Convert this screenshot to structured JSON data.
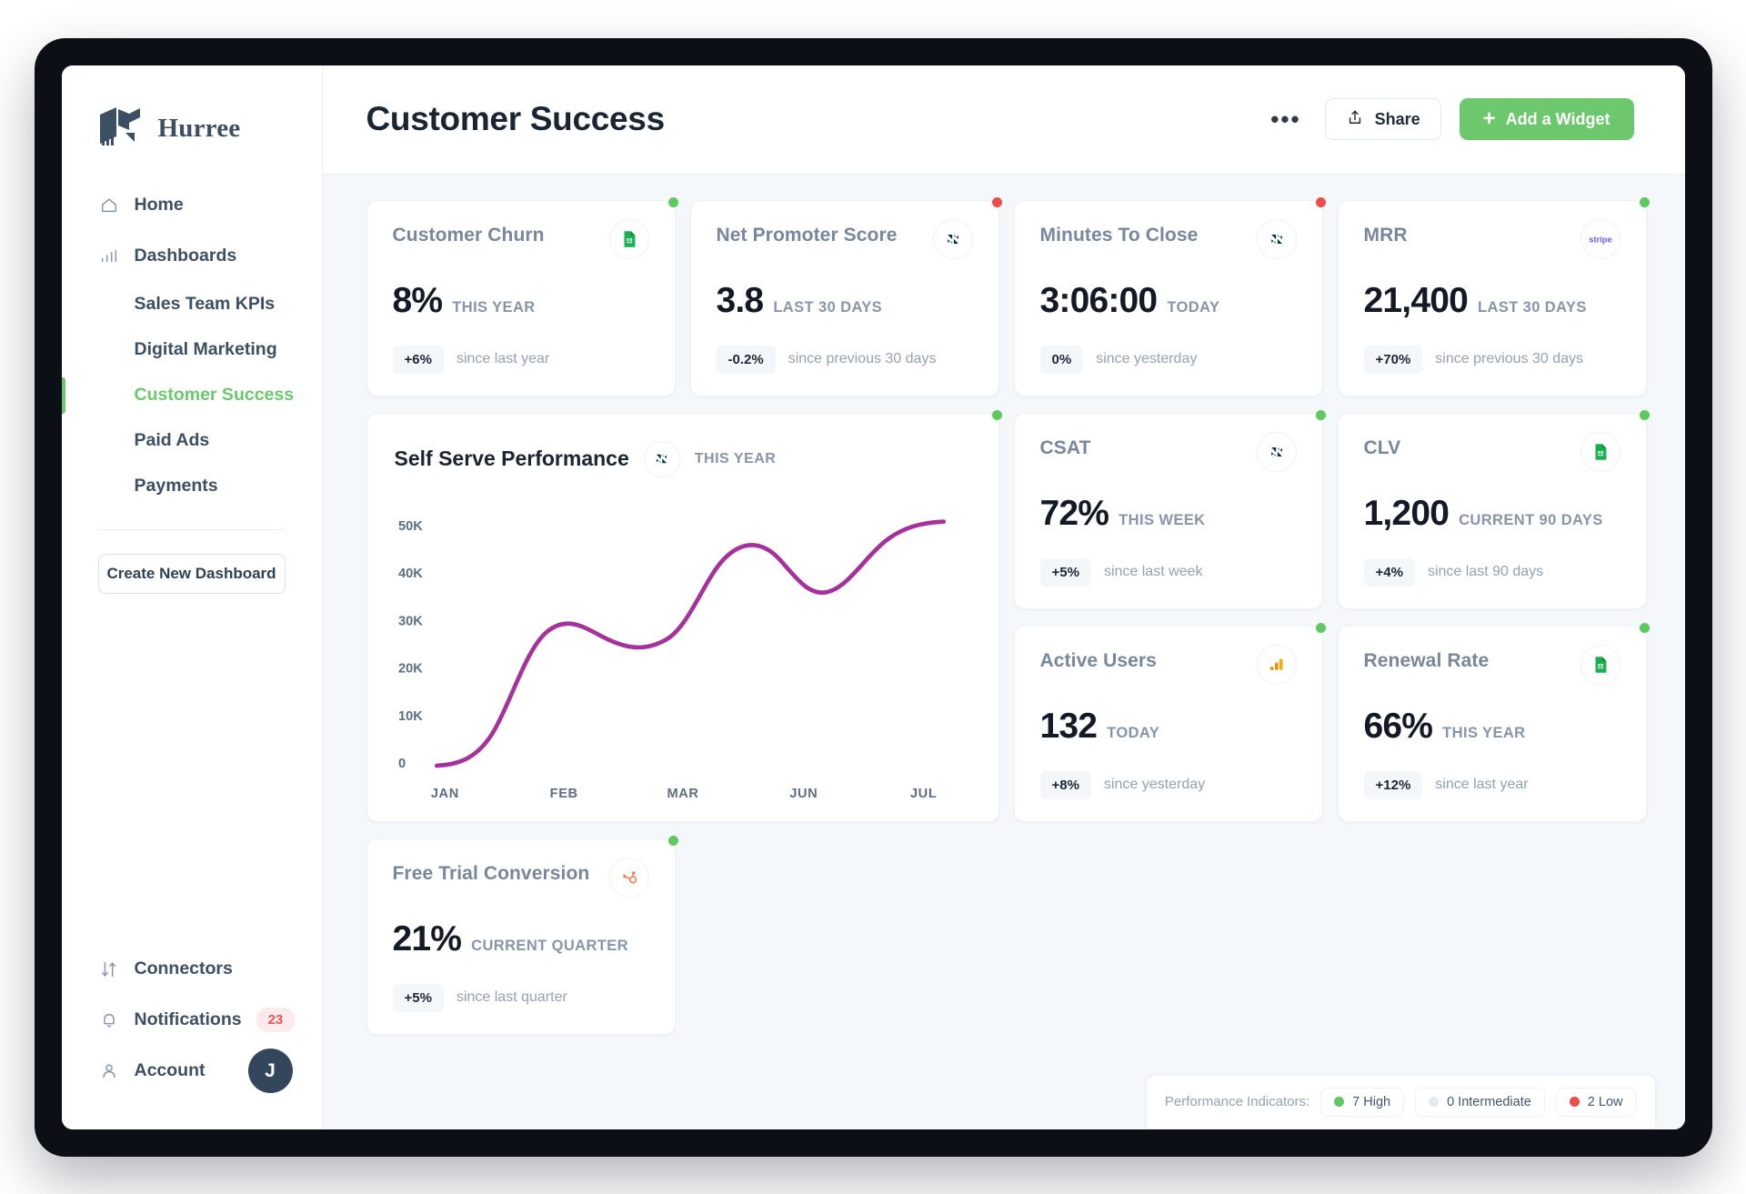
{
  "brand": {
    "name": "Hurree",
    "logo_icon": "hurree-logo-icon"
  },
  "sidebar": {
    "primary": [
      {
        "label": "Home",
        "icon": "home-icon"
      },
      {
        "label": "Dashboards",
        "icon": "bar-chart-icon"
      }
    ],
    "dashboards": [
      {
        "label": "Sales Team KPIs",
        "active": false
      },
      {
        "label": "Digital Marketing",
        "active": false
      },
      {
        "label": "Customer Success",
        "active": true
      },
      {
        "label": "Paid Ads",
        "active": false
      },
      {
        "label": "Payments",
        "active": false
      }
    ],
    "create_button": "Create New Dashboard",
    "bottom": [
      {
        "label": "Connectors",
        "icon": "transfer-icon"
      },
      {
        "label": "Notifications",
        "icon": "bell-icon",
        "badge": "23"
      },
      {
        "label": "Account",
        "icon": "user-icon",
        "avatar": "J"
      }
    ]
  },
  "header": {
    "title": "Customer Success",
    "more_label": "•••",
    "share_label": "Share",
    "add_widget_label": "Add a Widget"
  },
  "cards": [
    {
      "title": "Customer Churn",
      "value": "8%",
      "period": "THIS YEAR",
      "delta": "+6%",
      "delta_label": "since last year",
      "source_icon": "google-sheets-icon",
      "status": "high"
    },
    {
      "title": "Net Promoter Score",
      "value": "3.8",
      "period": "LAST 30 DAYS",
      "delta": "-0.2%",
      "delta_label": "since previous 30 days",
      "source_icon": "zendesk-icon",
      "status": "low"
    },
    {
      "title": "Minutes To Close",
      "value": "3:06:00",
      "period": "TODAY",
      "delta": "0%",
      "delta_label": "since yesterday",
      "source_icon": "zendesk-icon",
      "status": "low"
    },
    {
      "title": "MRR",
      "value": "21,400",
      "period": "LAST 30 DAYS",
      "delta": "+70%",
      "delta_label": "since previous 30 days",
      "source_icon": "stripe-icon",
      "status": "high"
    },
    {
      "title": "CSAT",
      "value": "72%",
      "period": "THIS WEEK",
      "delta": "+5%",
      "delta_label": "since last week",
      "source_icon": "zendesk-icon",
      "status": "high"
    },
    {
      "title": "CLV",
      "value": "1,200",
      "period": "CURRENT 90 DAYS",
      "delta": "+4%",
      "delta_label": "since last 90 days",
      "source_icon": "google-sheets-icon",
      "status": "high"
    },
    {
      "title": "Active Users",
      "value": "132",
      "period": "TODAY",
      "delta": "+8%",
      "delta_label": "since yesterday",
      "source_icon": "google-analytics-icon",
      "status": "high"
    },
    {
      "title": "Renewal Rate",
      "value": "66%",
      "period": "THIS YEAR",
      "delta": "+12%",
      "delta_label": "since last year",
      "source_icon": "google-sheets-icon",
      "status": "high"
    },
    {
      "title": "Free Trial Conversion",
      "value": "21%",
      "period": "CURRENT QUARTER",
      "delta": "+5%",
      "delta_label": "since last quarter",
      "source_icon": "hubspot-icon",
      "status": "high"
    }
  ],
  "chart_card": {
    "title": "Self Serve Performance",
    "period": "THIS YEAR",
    "source_icon": "zendesk-icon",
    "status": "high"
  },
  "chart_data": {
    "type": "line",
    "title": "Self Serve Performance",
    "subtitle": "THIS YEAR",
    "xlabel": "",
    "ylabel": "",
    "categories": [
      "JAN",
      "FEB",
      "MAR",
      "JUN",
      "JUL"
    ],
    "x_tick_labels": [
      "JAN",
      "FEB",
      "MAR",
      "JUN",
      "JUL"
    ],
    "y_tick_labels": [
      "0",
      "10K",
      "20K",
      "30K",
      "40K",
      "50K"
    ],
    "ylim": [
      0,
      55000
    ],
    "grid": false,
    "legend": "none",
    "line_color": "#a5329c",
    "series": [
      {
        "name": "Self Serve Performance",
        "values": [
          600,
          31500,
          29500,
          47500,
          52000
        ],
        "points": [
          {
            "x": "JAN",
            "y": 600
          },
          {
            "x": "FEB",
            "y": 31500
          },
          {
            "x": "MAR",
            "y": 29500
          },
          {
            "x": "JUN",
            "y": 47500
          },
          {
            "x": "JUL",
            "y": 52000
          }
        ]
      }
    ]
  },
  "indicators": {
    "label": "Performance Indicators:",
    "chips": [
      {
        "text": "7 High",
        "color": "#5fc95f"
      },
      {
        "text": "0 Intermediate",
        "color": "#e3e9ef"
      },
      {
        "text": "2 Low",
        "color": "#ef4b4b"
      }
    ]
  }
}
